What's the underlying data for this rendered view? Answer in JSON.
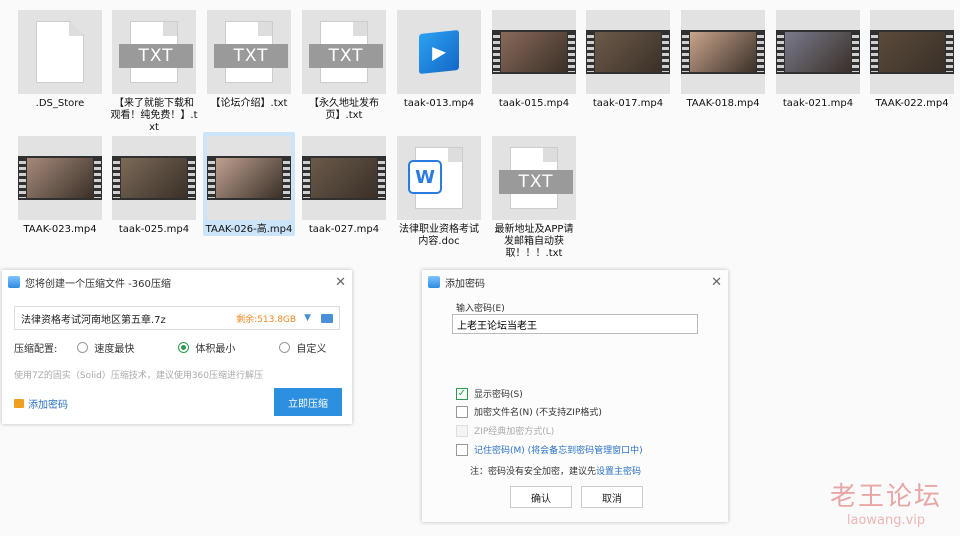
{
  "files_row1": [
    {
      "name": ".DS_Store",
      "kind": "blank"
    },
    {
      "name": "【来了就能下载和观看！纯免费！】.txt",
      "kind": "txt"
    },
    {
      "name": "【论坛介绍】.txt",
      "kind": "txt"
    },
    {
      "name": "【永久地址发布页】.txt",
      "kind": "txt"
    },
    {
      "name": "taak-013.mp4",
      "kind": "video-icon"
    },
    {
      "name": "taak-015.mp4",
      "kind": "video"
    },
    {
      "name": "taak-017.mp4",
      "kind": "video"
    },
    {
      "name": "TAAK-018.mp4",
      "kind": "video"
    },
    {
      "name": "taak-021.mp4",
      "kind": "video"
    },
    {
      "name": "TAAK-022.mp4",
      "kind": "video"
    }
  ],
  "files_row2": [
    {
      "name": "TAAK-023.mp4",
      "kind": "video"
    },
    {
      "name": "taak-025.mp4",
      "kind": "video"
    },
    {
      "name": "TAAK-026-高.mp4",
      "kind": "video",
      "selected": true
    },
    {
      "name": "taak-027.mp4",
      "kind": "video"
    },
    {
      "name": "法律职业资格考试内容.doc",
      "kind": "doc"
    },
    {
      "name": "最新地址及APP请发邮箱自动获取！！！.txt",
      "kind": "txt"
    }
  ],
  "txt_label": "TXT",
  "word_glyph": "W",
  "play_glyph": "▶",
  "compress_dialog": {
    "title": "您将创建一个压缩文件 -360压缩",
    "close": "✕",
    "path": "法律资格考试河南地区第五章.7z",
    "free_space": "剩余:513.8GB",
    "dropdown": "▼",
    "config_label": "压缩配置:",
    "options": [
      "速度最快",
      "体积最小",
      "自定义"
    ],
    "selected_option": "体积最小",
    "hint": "使用7Z的固实（Solid）压缩技术，建议使用360压缩进行解压",
    "add_password": "添加密码",
    "compress_button": "立即压缩"
  },
  "password_dialog": {
    "title": "添加密码",
    "close": "✕",
    "input_label": "输入密码(E)",
    "password_value": "上老王论坛当老王",
    "show_password": "显示密码(S)",
    "show_password_checked": true,
    "encrypt_names": "加密文件名(N) (不支持ZIP格式)",
    "zip_classic": "ZIP经典加密方式(L)",
    "remember": "记住密码(M) (将会备忘到密码管理窗口中)",
    "check_glyph": "✓",
    "note_prefix": "注：密码没有安全加密，建议先",
    "note_link": "设置主密码",
    "ok": "确认",
    "cancel": "取消"
  },
  "watermark": {
    "title": "老王论坛",
    "url": "laowang.vip"
  },
  "colors": {
    "accent": "#2d8fe0",
    "selection": "#cce4f7",
    "free_space": "#f08a24",
    "link": "#2a72c4"
  }
}
